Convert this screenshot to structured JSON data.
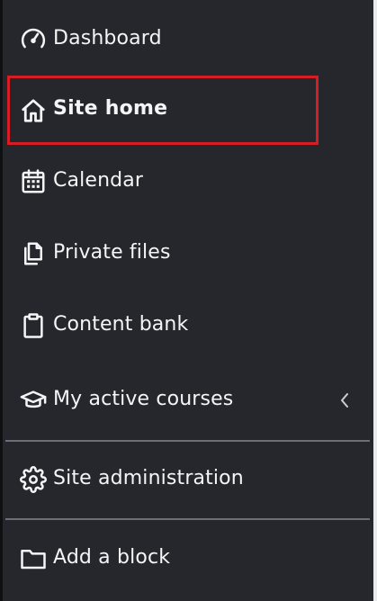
{
  "menu": {
    "items": [
      {
        "label": "Dashboard",
        "icon": "tachometer-icon"
      },
      {
        "label": "Site home",
        "icon": "home-icon"
      },
      {
        "label": "Calendar",
        "icon": "calendar-icon"
      },
      {
        "label": "Private files",
        "icon": "files-icon"
      },
      {
        "label": "Content bank",
        "icon": "clipboard-icon"
      },
      {
        "label": "My active courses",
        "icon": "graduation-cap-icon"
      },
      {
        "label": "Site administration",
        "icon": "gear-icon"
      },
      {
        "label": "Add a block",
        "icon": "folder-icon"
      }
    ]
  },
  "colors": {
    "background": "#25272c",
    "text": "#f4f5f7",
    "highlight": "#d71d24"
  }
}
